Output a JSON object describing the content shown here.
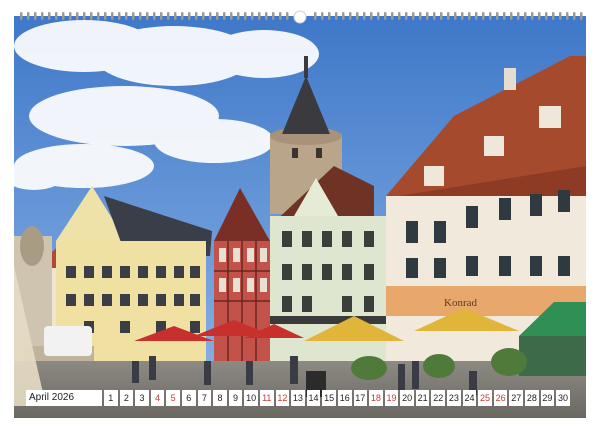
{
  "calendar": {
    "month_label": "April 2026",
    "days": [
      {
        "n": "1",
        "weekend": false
      },
      {
        "n": "2",
        "weekend": false
      },
      {
        "n": "3",
        "weekend": false
      },
      {
        "n": "4",
        "weekend": true
      },
      {
        "n": "5",
        "weekend": true
      },
      {
        "n": "6",
        "weekend": false
      },
      {
        "n": "7",
        "weekend": false
      },
      {
        "n": "8",
        "weekend": false
      },
      {
        "n": "9",
        "weekend": false
      },
      {
        "n": "10",
        "weekend": false
      },
      {
        "n": "11",
        "weekend": true
      },
      {
        "n": "12",
        "weekend": true
      },
      {
        "n": "13",
        "weekend": false
      },
      {
        "n": "14",
        "weekend": false
      },
      {
        "n": "15",
        "weekend": false
      },
      {
        "n": "16",
        "weekend": false
      },
      {
        "n": "17",
        "weekend": false
      },
      {
        "n": "18",
        "weekend": true
      },
      {
        "n": "19",
        "weekend": true
      },
      {
        "n": "20",
        "weekend": false
      },
      {
        "n": "21",
        "weekend": false
      },
      {
        "n": "22",
        "weekend": false
      },
      {
        "n": "23",
        "weekend": false
      },
      {
        "n": "24",
        "weekend": false
      },
      {
        "n": "25",
        "weekend": true
      },
      {
        "n": "26",
        "weekend": true
      },
      {
        "n": "27",
        "weekend": false
      },
      {
        "n": "28",
        "weekend": false
      },
      {
        "n": "29",
        "weekend": false
      },
      {
        "n": "30",
        "weekend": false
      }
    ]
  },
  "photo": {
    "shop_sign": "Konrad",
    "colors": {
      "sky": "#4f86d0",
      "umbrella_red": "#c8302e",
      "umbrella_yellow": "#e0b53a",
      "awning_green": "#2f8f55",
      "roof_brown": "#7a3b2a",
      "weekend_digit": "#c9393b"
    }
  }
}
